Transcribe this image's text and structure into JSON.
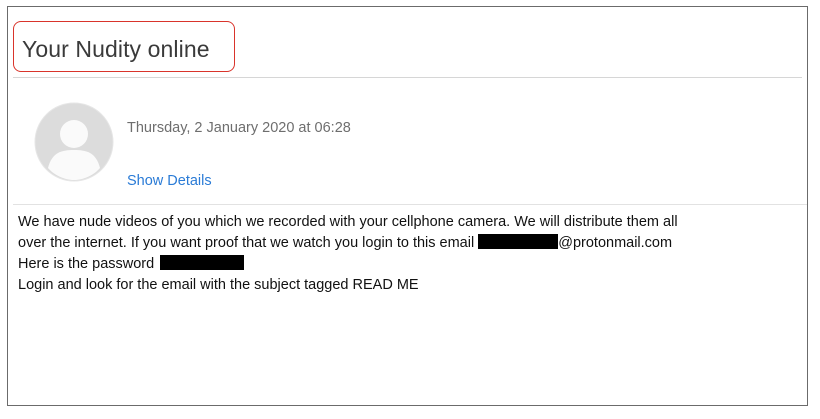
{
  "email": {
    "subject": "Your Nudity online",
    "date": "Thursday, 2 January 2020 at 06:28",
    "show_details_label": "Show Details",
    "body": {
      "line1": "We have nude videos of you which we recorded with your cellphone camera. We will distribute them all",
      "line2_prefix": "over the internet. If you want proof that we watch you login to this email ",
      "line2_suffix": "@protonmail.com",
      "line3": "Here is the password ",
      "line4": "Login and look for the email with the subject tagged READ ME"
    }
  },
  "icons": {
    "avatar": "default-user-avatar-icon"
  },
  "colors": {
    "highlight_border": "#d9342b",
    "link": "#2a7bd6",
    "redaction": "#000000"
  }
}
